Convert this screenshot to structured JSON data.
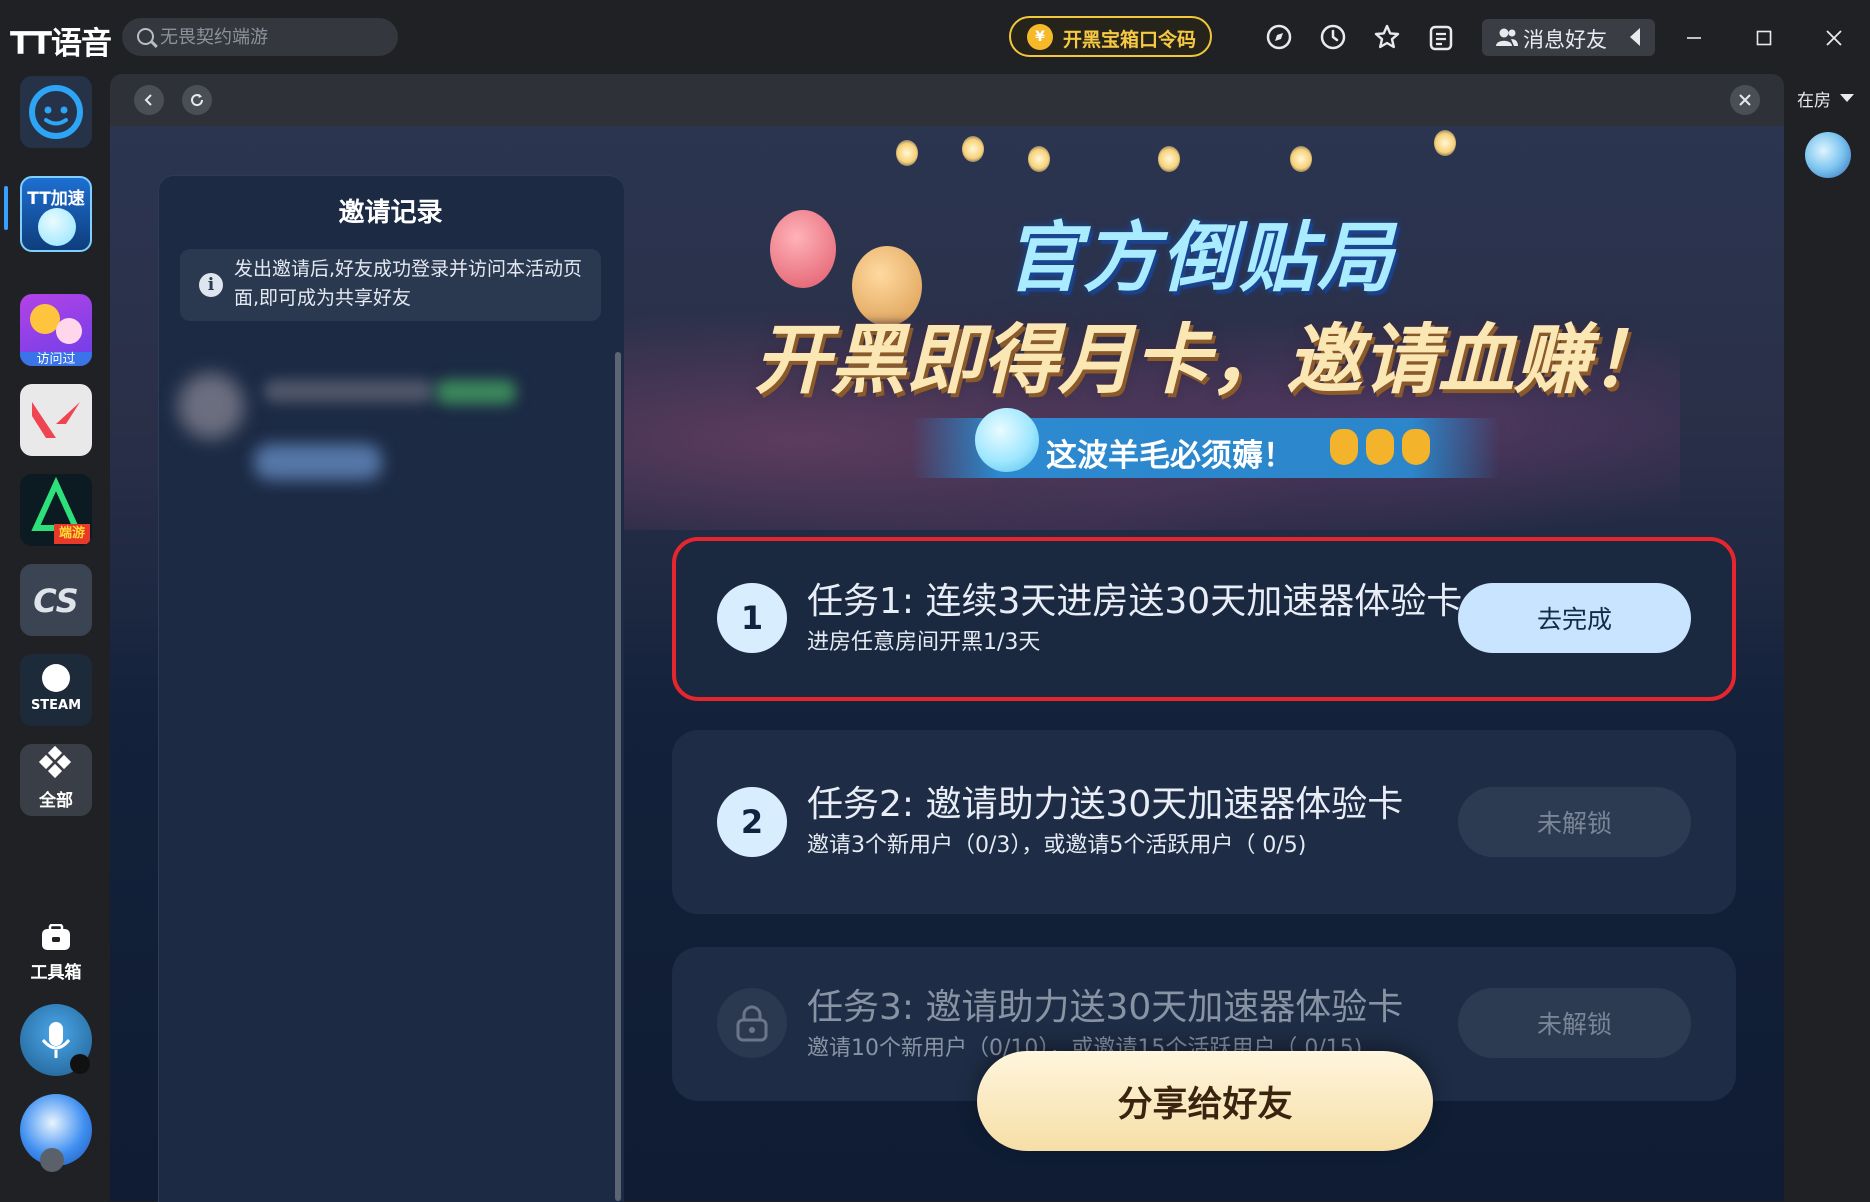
{
  "app": {
    "logo": "TT语音",
    "search": {
      "placeholder": "无畏契约端游"
    },
    "promo_label": "开黑宝箱口令码",
    "friends_label": "消息好友",
    "toolbar_icons": [
      "compass-icon",
      "history-icon",
      "star-icon",
      "clipboard-icon"
    ]
  },
  "sidebar": {
    "items": [
      {
        "name": "tt-logo",
        "label": ""
      },
      {
        "name": "tt-accelerator",
        "label": "TT加速"
      },
      {
        "name": "visited",
        "label": "访问过"
      },
      {
        "name": "valorant",
        "label": ""
      },
      {
        "name": "league-mobile",
        "label": "端游"
      },
      {
        "name": "cs",
        "label": "CS"
      },
      {
        "name": "steam",
        "label": "STEAM"
      },
      {
        "name": "all",
        "label": "全部"
      }
    ],
    "toolbox_label": "工具箱"
  },
  "right_rail": {
    "status_label": "在房"
  },
  "invite_panel": {
    "title": "邀请记录",
    "info": "发出邀请后,好友成功登录并访问本活动页面,即可成为共享好友"
  },
  "hero": {
    "line1": "官方倒贴局",
    "line2": "开黑即得月卡，邀请血赚！",
    "ribbon": "这波羊毛必须薅！"
  },
  "tasks": [
    {
      "number": "1",
      "title": "任务1: 连续3天进房送30天加速器体验卡",
      "subtitle": "进房任意房间开黑1/3天",
      "button": "去完成",
      "state": "active"
    },
    {
      "number": "2",
      "title": "任务2: 邀请助力送30天加速器体验卡",
      "subtitle": "邀请3个新用户（0/3），或邀请5个活跃用户（ 0/5)",
      "button": "未解锁",
      "state": "locked"
    },
    {
      "number": "",
      "title": "任务3: 邀请助力送30天加速器体验卡",
      "subtitle": "邀请10个新用户（0/10），或邀请15个活跃用户（ 0/15)",
      "button": "未解锁",
      "state": "locked"
    }
  ],
  "share_button": "分享给好友",
  "colors": {
    "highlight": "#e6262e",
    "accent_button": "#c8e4ff",
    "promo_gold": "#f2c73a"
  }
}
